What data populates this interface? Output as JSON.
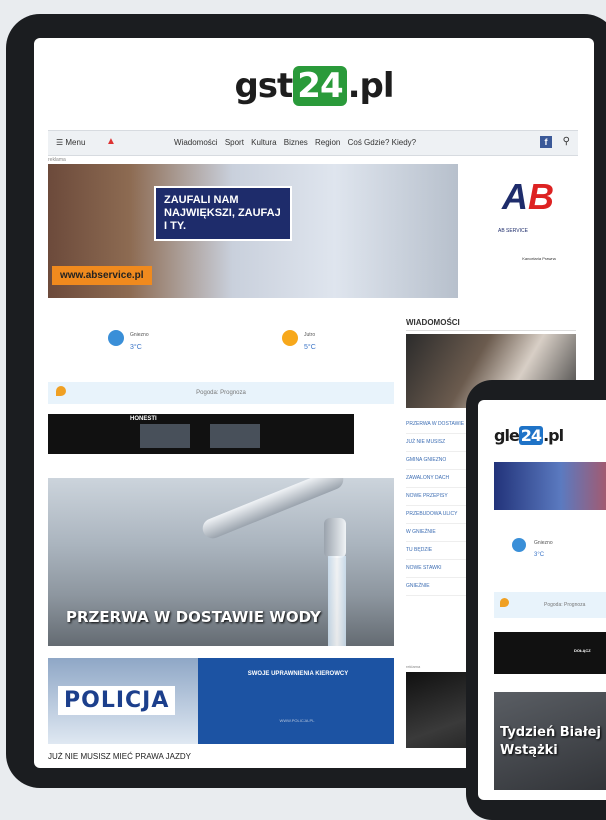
{
  "site": {
    "logo_pre": "gst",
    "logo_num": "24",
    "logo_post": ".pl"
  },
  "nav": {
    "menu_label": "☰ Menu",
    "links": [
      "Wiadomości",
      "Sport",
      "Kultura",
      "Biznes",
      "Region",
      "Coś Gdzie? Kiedy?"
    ],
    "fb": "f"
  },
  "ad_label": "reklama",
  "banner": {
    "slogan": "ZAUFALI NAM NAJWIĘKSZI, ZAUFAJ I TY.",
    "url": "www.abservice.pl",
    "logo_a": "A",
    "logo_b": "B",
    "company": "AB SERVICE",
    "small_text": "Kancelaria Prawna"
  },
  "weather": {
    "left": {
      "city": "Gniezno",
      "temp": "3°C"
    },
    "right": {
      "city": "Jutro",
      "temp": "5°C"
    },
    "pogoda_label": "Pogoda: Prognoza"
  },
  "honest_ad": {
    "title": "HONESTI"
  },
  "lead_story": {
    "title": "PRZERWA W DOSTAWIE WODY"
  },
  "policja": {
    "word": "POLICJA",
    "t1": "SWOJE UPRAWNIENIA KIEROWCY",
    "t2": "WWW.POLICJA.PL"
  },
  "policja_caption": "JUŻ NIE MUSISZ MIEĆ PRAWA JAZDY",
  "wiadomosci": {
    "header": "WIADOMOŚCI",
    "items": [
      "PRZERWA W DOSTAWIE",
      "JUŻ NIE MUSISZ",
      "GMINA GNIEZNO",
      "ZAWALONY DACH",
      "NOWE PRZEPISY",
      "PRZEBUDOWA ULICY",
      "W GNIEŹNIE",
      "TU BĘDZIE",
      "NOWE STAWKI",
      "GNIEŹNIE"
    ],
    "small_label": "reklama"
  },
  "phone": {
    "logo_pre": "gle",
    "logo_num": "24",
    "logo_post": ".pl",
    "weather_city": "Gniezno",
    "weather_temp": "3°C",
    "pogoda_label": "Pogoda: Prognoza",
    "ad_text": "DOŁĄCZ",
    "news_title": "Tydzień Białej Wstążki"
  }
}
